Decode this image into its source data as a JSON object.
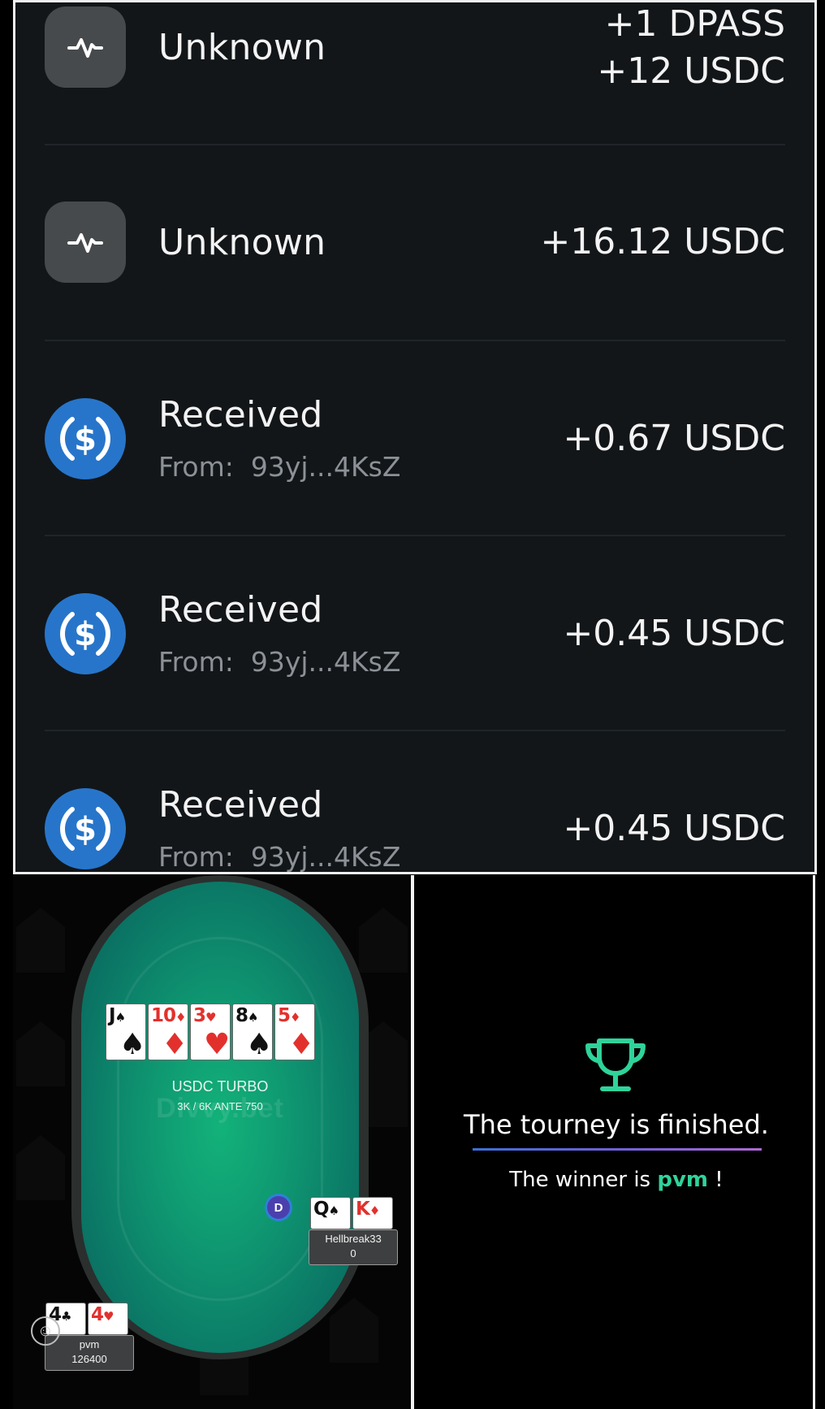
{
  "wallet": {
    "transactions": [
      {
        "type_icon": "activity-icon",
        "title": "Unknown",
        "subtitle": "",
        "amount_lines": [
          "+1 DPASS",
          "+12 USDC"
        ]
      },
      {
        "type_icon": "activity-icon",
        "title": "Unknown",
        "subtitle": "",
        "amount_lines": [
          "+16.12 USDC"
        ]
      },
      {
        "type_icon": "usdc-icon",
        "title": "Received",
        "subtitle": "From:  93yj...4KsZ",
        "amount_lines": [
          "+0.67 USDC"
        ]
      },
      {
        "type_icon": "usdc-icon",
        "title": "Received",
        "subtitle": "From:  93yj...4KsZ",
        "amount_lines": [
          "+0.45 USDC"
        ]
      },
      {
        "type_icon": "usdc-icon",
        "title": "Received",
        "subtitle": "From:  93yj...4KsZ",
        "amount_lines": [
          "+0.45 USDC"
        ]
      }
    ]
  },
  "poker": {
    "table_name": "USDC TURBO",
    "blinds": "3K / 6K ANTE 750",
    "watermark": "Divvy.bet",
    "dealer_button": "D",
    "board": [
      {
        "rank": "J",
        "suit": "♠",
        "color": "black"
      },
      {
        "rank": "10",
        "suit": "♦",
        "color": "red"
      },
      {
        "rank": "3",
        "suit": "♥",
        "color": "red"
      },
      {
        "rank": "8",
        "suit": "♠",
        "color": "black"
      },
      {
        "rank": "5",
        "suit": "♦",
        "color": "red"
      }
    ],
    "players": [
      {
        "name": "Hellbreak33",
        "stack": "0",
        "cards": [
          {
            "rank": "Q",
            "suit": "♠",
            "color": "black"
          },
          {
            "rank": "K",
            "suit": "♦",
            "color": "red"
          }
        ]
      },
      {
        "name": "pvm",
        "stack": "126400",
        "cards": [
          {
            "rank": "4",
            "suit": "♣",
            "color": "black"
          },
          {
            "rank": "4",
            "suit": "♥",
            "color": "red"
          }
        ]
      }
    ],
    "emoji_icon": "smiley-icon"
  },
  "tourney": {
    "icon": "trophy-icon",
    "title": "The tourney is finished.",
    "winner_prefix": "The winner is ",
    "winner_name": "pvm",
    "winner_suffix": " !",
    "accent_color": "#2fd39a"
  }
}
